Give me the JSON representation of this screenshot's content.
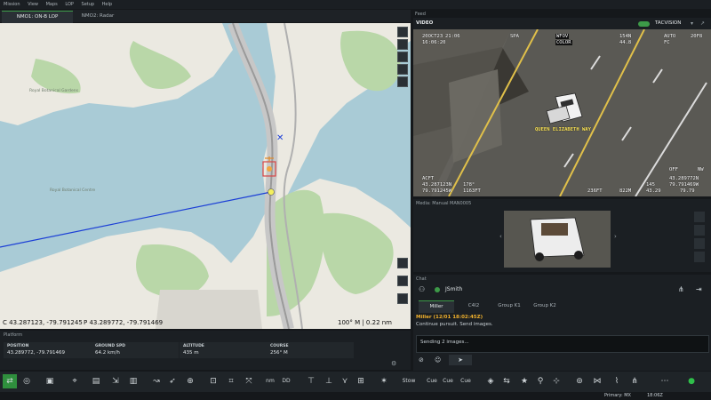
{
  "menu": [
    "Mission",
    "View",
    "Maps",
    "LOP",
    "Setup",
    "Help"
  ],
  "map": {
    "tabs": [
      "NMO1: ON-B LOP",
      "NMO2: Radar"
    ],
    "labels": {
      "royal_garden": "Royal Botanical Gardens",
      "north_park": "Royal Botanical Centre"
    },
    "coords_left": "C 43.287123, -79.791245",
    "coords_mid": "P 43.289772, -79.791469",
    "scale": "100° M | 0.22 nm"
  },
  "feed": {
    "header": "Feed",
    "video_label": "VIDEO",
    "mode": "TACVISION",
    "hud": {
      "date": "20OCT23",
      "time": "16:06:20",
      "utc": "21:06",
      "spa": "SPA",
      "fov": "WFOV",
      "color": "COLOR",
      "az": "154N",
      "range": "44.8",
      "auto": "AUTO",
      "fc": "FC",
      "rng_w": "20F8",
      "street": "QUEEN ELIZABETH WAY",
      "acft": "ACFT",
      "lat": "43.287123N",
      "lon": "79.791245W",
      "hdg": "178°",
      "alt": "1163FT",
      "off": "OFF",
      "nw": "NW",
      "tgt_lat": "43.289772N",
      "tgt_lon": "79.791469W",
      "tgt_hdg": "236FT",
      "tgt_alt": "822M",
      "t1": "145",
      "t2": "43.29",
      "t3": "79.79"
    }
  },
  "media": {
    "title": "Media: Manual MAN0005"
  },
  "chat": {
    "title": "Chat",
    "user": "JSmith",
    "tabs": [
      "Miller",
      "C4I2",
      "Group K1",
      "Group K2"
    ],
    "message_sender": "Miller (12/01 18:02:45Z)",
    "message_text": "Continue pursuit. Send images.",
    "input_text": "Sending 2 images..."
  },
  "platform": {
    "title": "Platform",
    "fields": [
      {
        "label": "POSITION",
        "value": "43.289772, -79.791469"
      },
      {
        "label": "GROUND SPD",
        "value": "64.2 km/h"
      },
      {
        "label": "ALTITUDE",
        "value": "435 m"
      },
      {
        "label": "COURSE",
        "value": "256° M"
      }
    ]
  },
  "status": {
    "primary": "Primary: MX",
    "time": "18:06Z"
  }
}
